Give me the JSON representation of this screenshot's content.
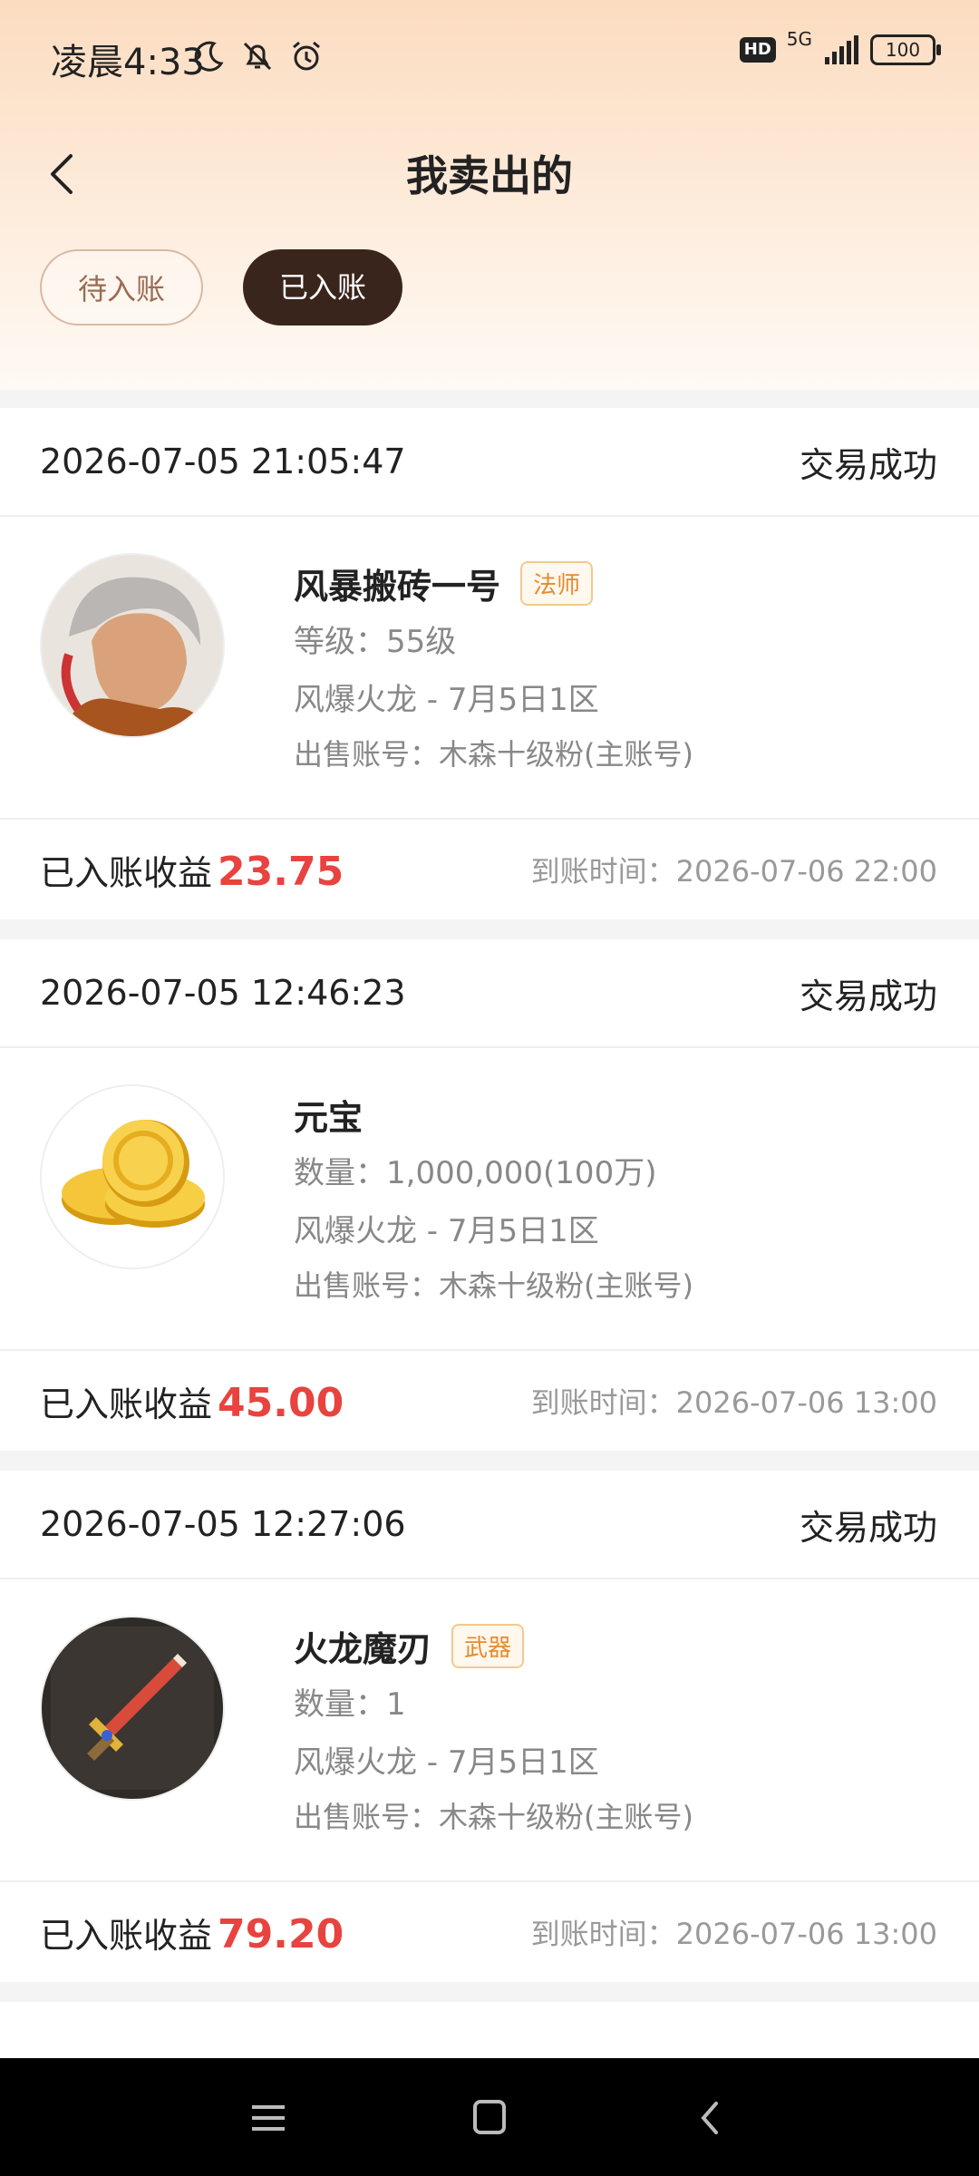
{
  "status_bar": {
    "time": "凌晨4:33",
    "icons": [
      "moon-icon",
      "mute-bell-icon",
      "alarm-icon"
    ],
    "hd": "HD",
    "network": "5G",
    "battery": "100"
  },
  "header": {
    "title": "我卖出的",
    "tabs": [
      {
        "label": "待入账",
        "active": false
      },
      {
        "label": "已入账",
        "active": true
      }
    ]
  },
  "orders": [
    {
      "datetime": "2026-07-05 21:05:47",
      "status": "交易成功",
      "name": "风暴搬砖一号",
      "tag": "法师",
      "detail": "等级：55级",
      "server": "风爆火龙 - 7月5日1区",
      "account": "出售账号：木森十级粉(主账号)",
      "income_label": "已入账收益",
      "income": "23.75",
      "arrive": "到账时间：2026-07-06 22:00",
      "icon": "character-avatar"
    },
    {
      "datetime": "2026-07-05 12:46:23",
      "status": "交易成功",
      "name": "元宝",
      "tag": "",
      "detail": "数量：1,000,000(100万)",
      "server": "风爆火龙 - 7月5日1区",
      "account": "出售账号：木森十级粉(主账号)",
      "income_label": "已入账收益",
      "income": "45.00",
      "arrive": "到账时间：2026-07-06 13:00",
      "icon": "gold-coins"
    },
    {
      "datetime": "2026-07-05 12:27:06",
      "status": "交易成功",
      "name": "火龙魔刃",
      "tag": "武器",
      "detail": "数量：1",
      "server": "风爆火龙 - 7月5日1区",
      "account": "出售账号：木森十级粉(主账号)",
      "income_label": "已入账收益",
      "income": "79.20",
      "arrive": "到账时间：2026-07-06 13:00",
      "icon": "sword-item"
    }
  ]
}
